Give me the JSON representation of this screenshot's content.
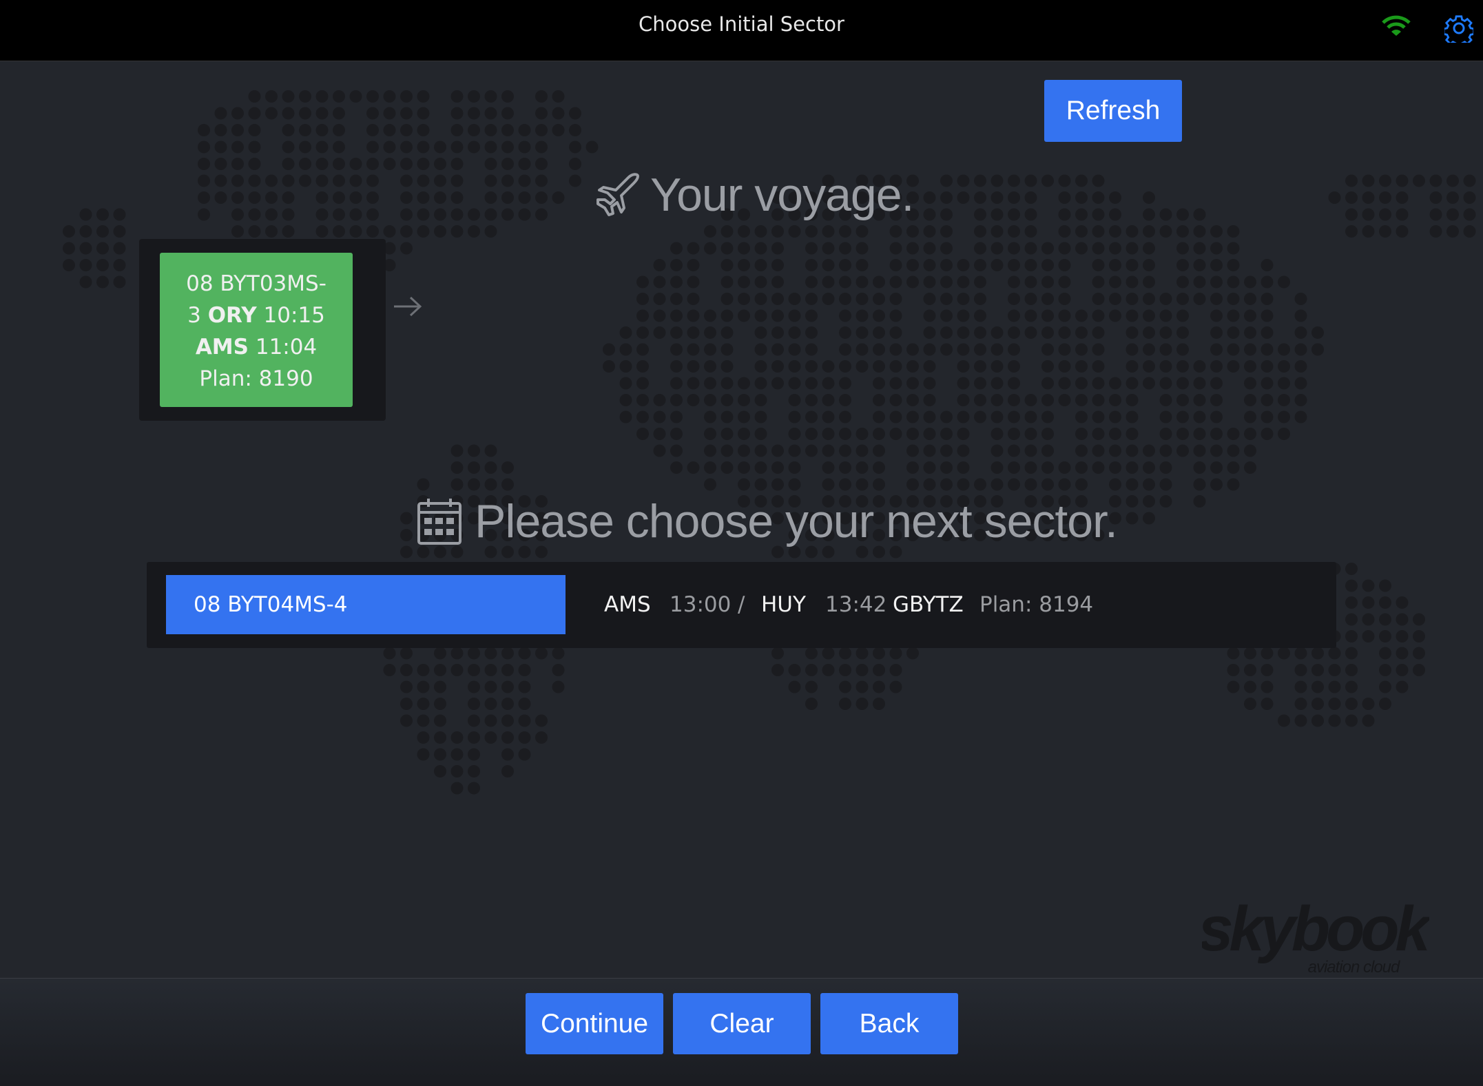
{
  "header": {
    "title": "Choose Initial Sector",
    "wifi_icon": "wifi-icon",
    "wifi_color": "#1a9a1a",
    "settings_icon": "gear-icon",
    "settings_color": "#1e7bff"
  },
  "refresh_label": "Refresh",
  "voyage": {
    "icon": "airplane-icon",
    "heading": "Your voyage."
  },
  "current_sector": {
    "line1": "08 BYT03MS-",
    "line2_prefix": "3",
    "origin": "ORY",
    "dep_time": "10:15",
    "destination": "AMS",
    "arr_time": "11:04",
    "plan": "Plan: 8190",
    "color": "#52b35f"
  },
  "choose": {
    "icon": "calendar-icon",
    "heading": "Please choose your next sector."
  },
  "next_sector": {
    "flight": "08 BYT04MS-4",
    "origin": "AMS",
    "dep_time": "13:00",
    "separator": "/",
    "destination": "HUY",
    "arr_time": "13:42",
    "registration": "GBYTZ",
    "plan": "Plan: 8194"
  },
  "footer": {
    "continue": "Continue",
    "clear": "Clear",
    "back": "Back"
  },
  "logo": {
    "name": "skybook",
    "tagline": "aviation cloud"
  },
  "accent": "#3473f0"
}
